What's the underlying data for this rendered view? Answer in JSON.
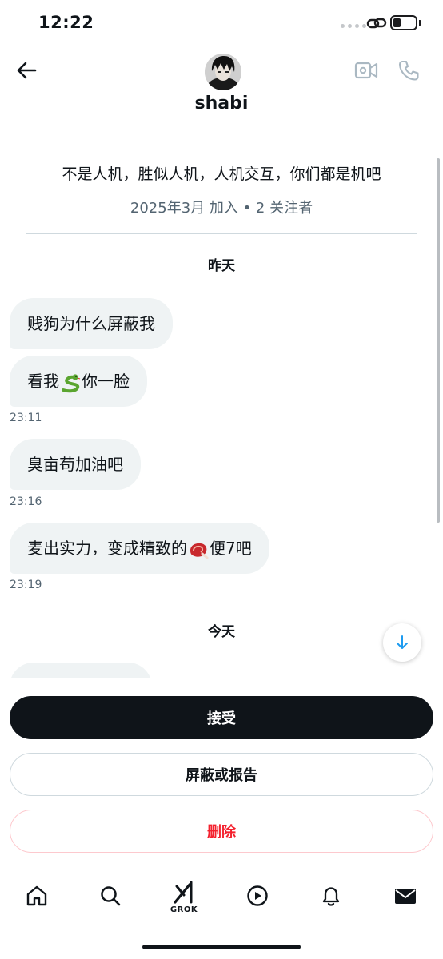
{
  "status_bar": {
    "time": "12:22"
  },
  "header": {
    "name": "shabi",
    "bio": "不是人机，胜似人机，人机交互，你们都是机吧",
    "meta": "2025年3月 加入 • 2 关注者"
  },
  "conversation": {
    "day_yesterday": "昨天",
    "day_today": "今天",
    "messages": [
      {
        "text": "贱狗为什么屏蔽我"
      },
      {
        "text_before": "看我",
        "text_after": "你一脸",
        "time": "23:11"
      },
      {
        "text": "臭亩苟加油吧",
        "time": "23:16"
      },
      {
        "text_before": "麦出实力，变成精致的",
        "text_after": "便7吧",
        "time": "23:19"
      }
    ]
  },
  "actions": {
    "accept": "接受",
    "block_or_report": "屏蔽或报告",
    "delete": "删除"
  },
  "tab_bar": {
    "grok_label": "GROK"
  },
  "colors": {
    "accent": "#1d9bf0",
    "danger": "#f4212e",
    "text": "#0f1419",
    "muted": "#536471",
    "bubble": "#eff3f4"
  }
}
